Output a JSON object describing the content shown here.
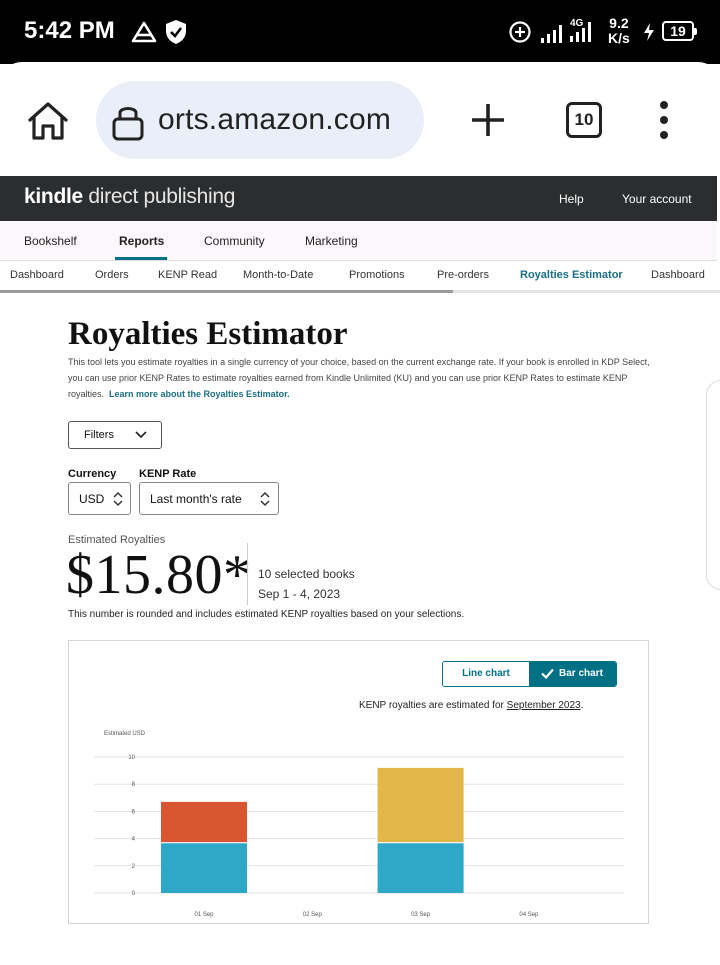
{
  "status_bar": {
    "time": "5:42 PM",
    "network_speed": "9.2",
    "network_unit": "K/s",
    "network_type": "4G",
    "battery": "19",
    "icons": [
      "warning-triangle-icon",
      "shield-check-icon",
      "data-saver-icon",
      "signal-icon",
      "signal-4g-icon",
      "charging-bolt-icon",
      "battery-icon"
    ]
  },
  "browser": {
    "url": "orts.amazon.com",
    "tab_count": "10",
    "icons": [
      "home-icon",
      "lock-icon",
      "new-tab-plus-icon",
      "overflow-menu-icon"
    ]
  },
  "kdp": {
    "logo_bold": "kindle",
    "logo_rest": " direct publishing",
    "help": "Help",
    "account": "Your account",
    "main_nav": [
      "Bookshelf",
      "Reports",
      "Community",
      "Marketing"
    ],
    "main_nav_active": "Reports",
    "sub_nav": [
      "Dashboard",
      "Orders",
      "KENP Read",
      "Month-to-Date",
      "Promotions",
      "Pre-orders",
      "Royalties Estimator",
      "Dashboard"
    ],
    "sub_nav_active": "Royalties Estimator",
    "accent_color": "#007185"
  },
  "page": {
    "title": "Royalties Estimator",
    "intro": "This tool lets you estimate royalties in a single currency of your choice, based on the current exchange rate. If your book is enrolled in KDP Select, you can use prior KENP Rates to estimate royalties earned from Kindle Unlimited (KU) and you can use prior KENP Rates to estimate KENP royalties.",
    "intro_link": "Learn more about the Royalties Estimator.",
    "filters": "Filters",
    "currency_label": "Currency",
    "currency_value": "USD",
    "kenp_label": "KENP Rate",
    "kenp_value": "Last month's rate",
    "estimated_label": "Estimated Royalties",
    "estimated_value": "$15.80*",
    "selected_books": "10 selected books",
    "date_range": "Sep 1 - 4, 2023",
    "note": "This number is rounded and includes estimated KENP royalties based on your selections."
  },
  "chart": {
    "toggle_line": "Line chart",
    "toggle_bar": "Bar chart",
    "toggle_active": "Bar chart",
    "kenp_note_prefix": "KENP royalties are estimated for ",
    "kenp_note_month": "September 2023",
    "kenp_note_suffix": "."
  },
  "chart_data": {
    "type": "bar",
    "stacked": true,
    "title": "",
    "ylabel": "Estimated USD",
    "xlabel": "",
    "categories": [
      "01 Sep",
      "02 Sep",
      "03 Sep",
      "04 Sep"
    ],
    "ylim": [
      0,
      10
    ],
    "yticks": [
      0,
      2,
      4,
      6,
      8,
      10
    ],
    "grid": true,
    "series": [
      {
        "color": "#2fa8c7",
        "values": [
          3.7,
          0,
          3.7,
          0
        ]
      },
      {
        "color": "#d95532",
        "values": [
          3.0,
          0,
          0,
          0
        ]
      },
      {
        "color": "#e3b649",
        "values": [
          0,
          0,
          5.5,
          0
        ]
      }
    ]
  }
}
